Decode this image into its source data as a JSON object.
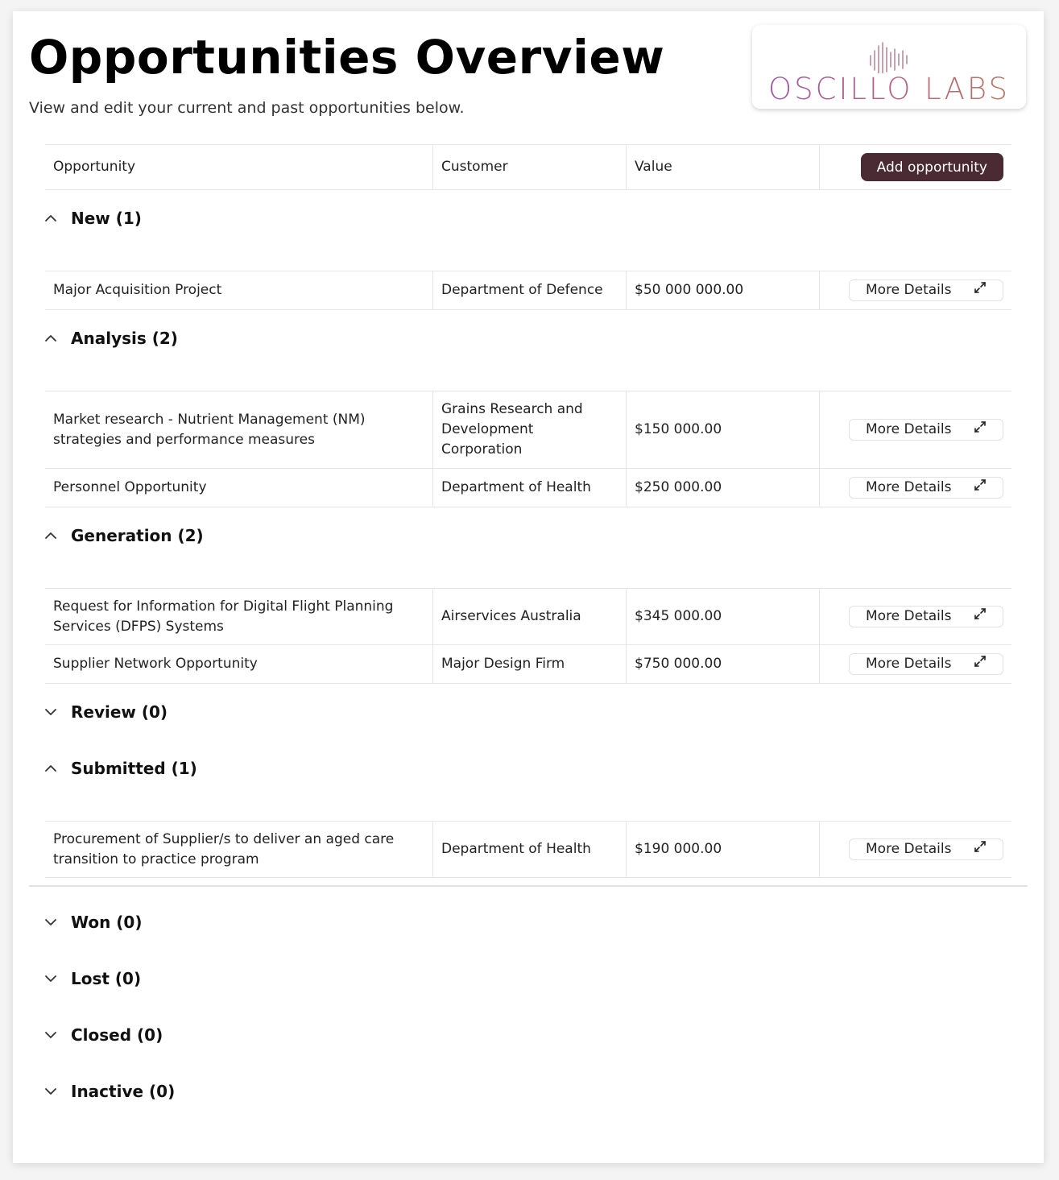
{
  "header": {
    "title": "Opportunities Overview",
    "subtitle": "View and edit your current and past opportunities below."
  },
  "logo": {
    "text": "OSCILLO LABS",
    "icon": "soundwave-icon"
  },
  "table": {
    "columns": [
      "Opportunity",
      "Customer",
      "Value"
    ],
    "add_button": "Add opportunity",
    "more_details_label": "More Details"
  },
  "groups": [
    {
      "label": "New (1)",
      "expanded": true,
      "rows": [
        {
          "opportunity": "Major Acquisition Project",
          "customer": "Department of Defence",
          "value": "$50 000 000.00"
        }
      ]
    },
    {
      "label": "Analysis (2)",
      "expanded": true,
      "rows": [
        {
          "opportunity": "Market research - Nutrient Management (NM) strategies and performance measures",
          "customer": "Grains Research and Development Corporation",
          "value": "$150 000.00"
        },
        {
          "opportunity": "Personnel Opportunity",
          "customer": "Department of Health",
          "value": "$250 000.00"
        }
      ]
    },
    {
      "label": "Generation (2)",
      "expanded": true,
      "rows": [
        {
          "opportunity": "Request for Information for Digital Flight Planning Services (DFPS) Systems",
          "customer": "Airservices Australia",
          "value": "$345 000.00"
        },
        {
          "opportunity": "Supplier Network Opportunity",
          "customer": "Major Design Firm",
          "value": "$750 000.00"
        }
      ]
    },
    {
      "label": "Review (0)",
      "expanded": false,
      "rows": []
    },
    {
      "label": "Submitted (1)",
      "expanded": true,
      "rows": [
        {
          "opportunity": "Procurement of Supplier/s to deliver an aged care transition to practice program",
          "customer": "Department of Health",
          "value": "$190 000.00"
        }
      ]
    },
    {
      "label": "Won (0)",
      "expanded": false,
      "rows": []
    },
    {
      "label": "Lost (0)",
      "expanded": false,
      "rows": []
    },
    {
      "label": "Closed (0)",
      "expanded": false,
      "rows": []
    },
    {
      "label": "Inactive (0)",
      "expanded": false,
      "rows": []
    }
  ],
  "colors": {
    "accent": "#4a2a33",
    "border": "#e6e6e6"
  }
}
